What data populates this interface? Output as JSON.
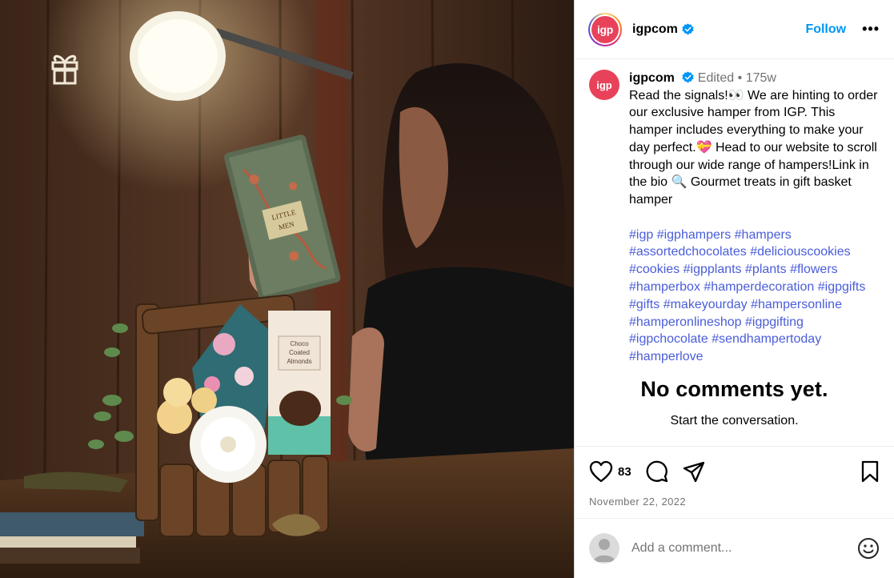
{
  "post": {
    "username": "igpcom",
    "avatar_text": "igp",
    "follow_label": "Follow",
    "more_label": "•••",
    "edited_label": "Edited",
    "separator": "•",
    "age": "175w",
    "caption": "Read the signals!👀 We are hinting to order our exclusive hamper from IGP. This hamper includes everything to make your day perfect.💝 Head to our website to scroll through our wide range of hampers!Link in the bio 🔍 Gourmet treats in gift basket hamper",
    "hashtags": [
      "#igp",
      "#igphampers",
      "#hampers",
      "#assortedchocolates",
      "#deliciouscookies",
      "#cookies",
      "#igpplants",
      "#plants",
      "#flowers",
      "#hamperbox",
      "#hamperdecoration",
      "#igpgifts",
      "#gifts",
      "#makeyourday",
      "#hampersonline",
      "#hamperonlineshop",
      "#igpgifting",
      "#igpchocolate",
      "#sendhampertoday",
      "#hamperlove"
    ],
    "no_comments_title": "No comments yet.",
    "no_comments_sub": "Start the conversation.",
    "likes": "83",
    "date": "November 22, 2022",
    "comment_placeholder": "Add a comment..."
  },
  "image": {
    "book_title": "LITTLE MEN",
    "box_text": "Choco\nCoated\nAlmonds"
  },
  "colors": {
    "accent": "#0095f6",
    "hashtag": "#4a5dd9",
    "brand": "#e8425a",
    "verified": "#0095f6"
  },
  "icons": [
    "igp-gift-logo-icon",
    "verified-icon",
    "more-icon",
    "heart-icon",
    "comment-icon",
    "share-icon",
    "bookmark-icon",
    "emoji-icon"
  ]
}
